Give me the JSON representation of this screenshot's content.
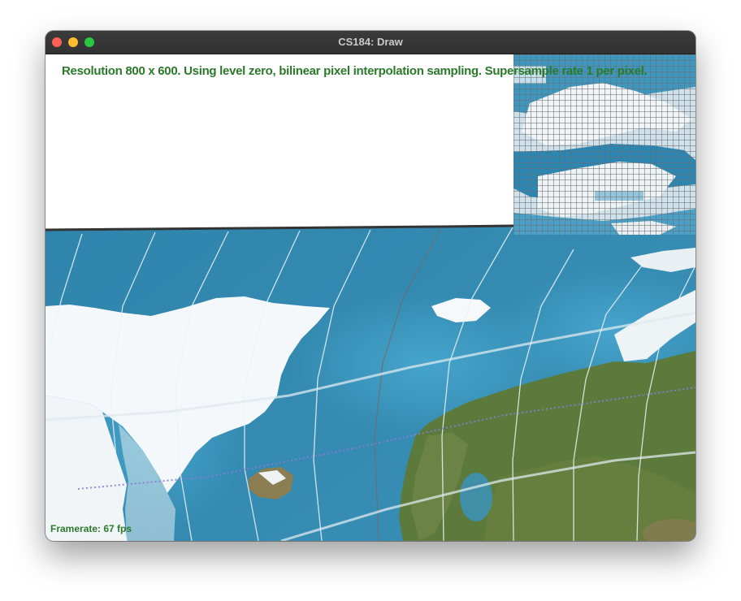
{
  "window": {
    "title": "CS184: Draw"
  },
  "overlay": {
    "status_text": "Resolution 800 x 600. Using level zero, bilinear pixel interpolation sampling. Supersample rate 1 per pixel.",
    "framerate_text": "Framerate: 67 fps"
  },
  "colors": {
    "ocean": "#2f86ae",
    "ice": "#f7fafb",
    "land": "#5d7a3a",
    "overlay_text": "#2a7a2a"
  }
}
